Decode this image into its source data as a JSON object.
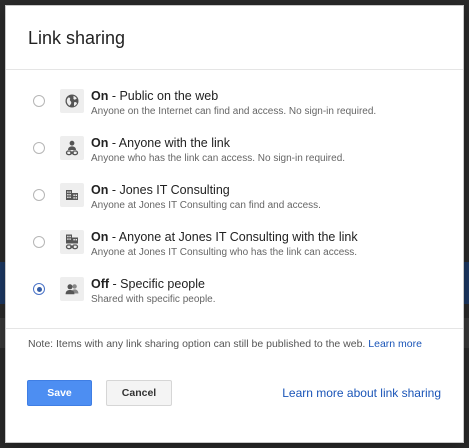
{
  "dialog": {
    "title": "Link sharing"
  },
  "options": [
    {
      "state": "On",
      "separator": " - ",
      "label": "Public on the web",
      "description": "Anyone on the Internet can find and access. No sign-in required.",
      "icon": "globe-icon",
      "selected": false
    },
    {
      "state": "On",
      "separator": " - ",
      "label": "Anyone with the link",
      "description": "Anyone who has the link can access. No sign-in required.",
      "icon": "person-link-icon",
      "selected": false
    },
    {
      "state": "On",
      "separator": " - ",
      "label": "Jones IT Consulting",
      "description": "Anyone at Jones IT Consulting can find and access.",
      "icon": "building-icon",
      "selected": false
    },
    {
      "state": "On",
      "separator": " - ",
      "label": "Anyone at Jones IT Consulting with the link",
      "description": "Anyone at Jones IT Consulting who has the link can access.",
      "icon": "building-link-icon",
      "selected": false
    },
    {
      "state": "Off",
      "separator": " - ",
      "label": "Specific people",
      "description": "Shared with specific people.",
      "icon": "people-icon",
      "selected": true
    }
  ],
  "note": {
    "text": "Note: Items with any link sharing option can still be published to the web.",
    "link": "Learn more"
  },
  "footer": {
    "save_label": "Save",
    "cancel_label": "Cancel",
    "learn_more_link": "Learn more about link sharing"
  },
  "colors": {
    "accent": "#4d8ef2",
    "link": "#1a55b8"
  }
}
